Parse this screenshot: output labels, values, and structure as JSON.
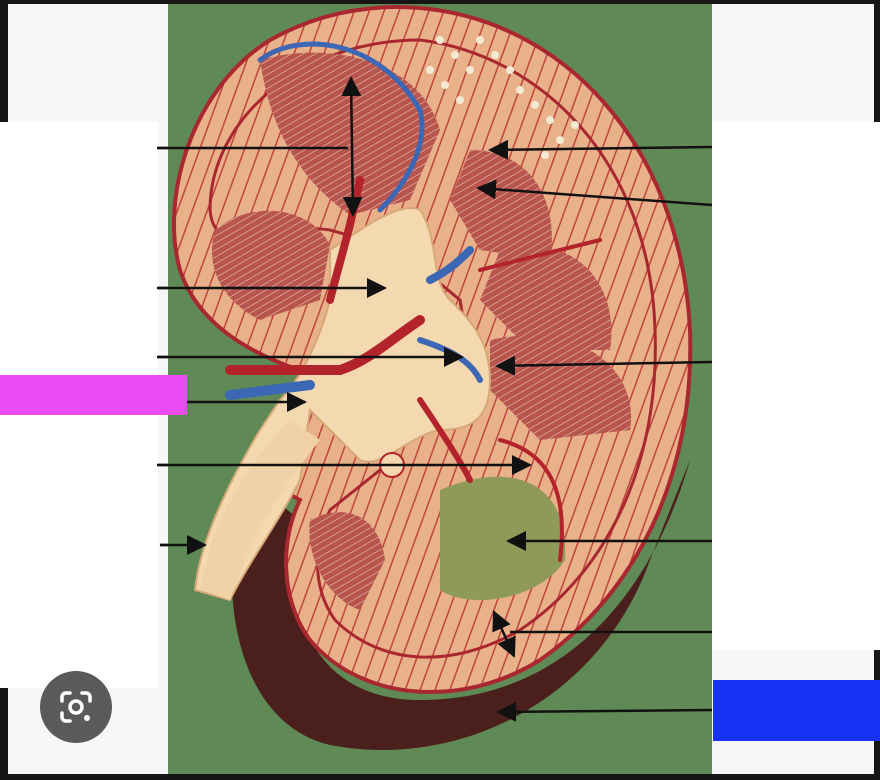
{
  "diagram": {
    "subject": "kidney-cross-section-model",
    "label_boxes": {
      "magenta_color": "#e84cf2",
      "blue_color": "#1731f5"
    },
    "colors": {
      "background_green": "#5f8a55",
      "cortex": "#e9b189",
      "pyramid": "#b8564e",
      "vessel_red": "#b3232b",
      "vein_blue": "#3c67b5",
      "pelvis": "#f4d8b0",
      "capsule": "#4a1f1c"
    }
  },
  "overlay": {
    "lens_icon": "google-lens-icon"
  }
}
